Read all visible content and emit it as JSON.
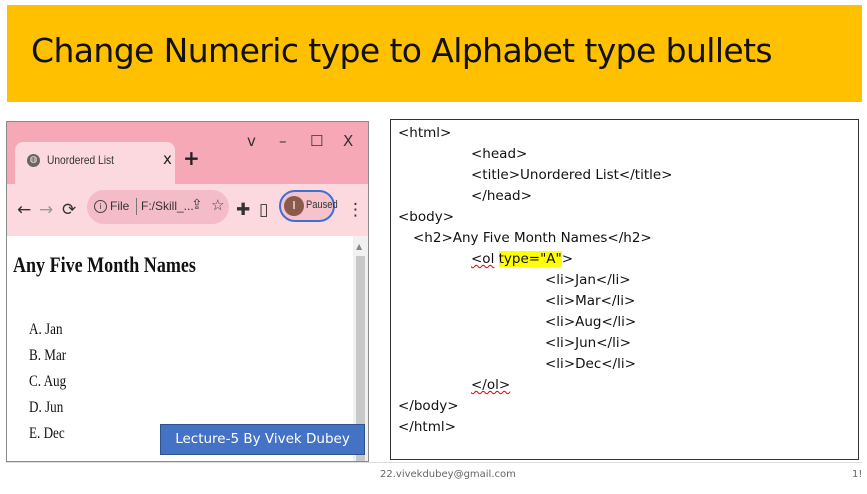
{
  "slide": {
    "title": "Change Numeric type to Alphabet type bullets",
    "footer_email": "22.vivekdubey@gmail.com",
    "footer_page": "1!",
    "lecture_label": "Lecture-5 By Vivek Dubey",
    "colors": {
      "banner": "#ffc000",
      "lecture_badge": "#4472c4",
      "highlight": "#ffff00"
    }
  },
  "browser": {
    "tab_title": "Unordered List",
    "tab_close": "x",
    "new_tab": "+",
    "window_controls": {
      "dropdown": "v",
      "minimize": "–",
      "maximize": "☐",
      "close": "X"
    },
    "omnibox": {
      "scheme_label": "File",
      "url": "F:/Skill_..."
    },
    "profile": {
      "initial": "I",
      "status": "Paused"
    },
    "page": {
      "heading": "Any Five Month Names",
      "list_items": [
        "A. Jan",
        "B. Mar",
        "C. Aug",
        "D. Jun",
        "E. Dec"
      ]
    },
    "colors": {
      "tabbar": "#f6a8b6",
      "toolbar": "#fbd9df"
    }
  },
  "code": {
    "lines": [
      "<html>",
      "<head>",
      "<title>Unordered List</title>",
      "</head>",
      "<body>",
      "<h2>Any Five Month Names</h2>",
      "<ol",
      "type=\"A\"",
      ">",
      "<li>Jan</li>",
      "<li>Mar</li>",
      "<li>Aug</li>",
      "<li>Jun</li>",
      "<li>Dec</li>",
      "</ol>",
      "</body>",
      "</html>"
    ]
  }
}
